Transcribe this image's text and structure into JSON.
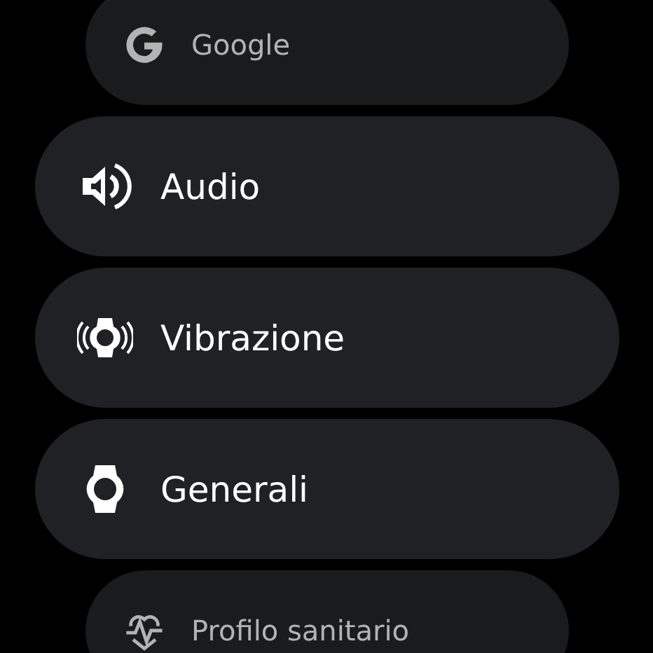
{
  "settings_list": [
    {
      "label": "Google",
      "faded": true
    },
    {
      "label": "Audio",
      "faded": false
    },
    {
      "label": "Vibrazione",
      "faded": false
    },
    {
      "label": "Generali",
      "faded": false
    },
    {
      "label": "Profilo sanitario",
      "faded": true
    }
  ]
}
